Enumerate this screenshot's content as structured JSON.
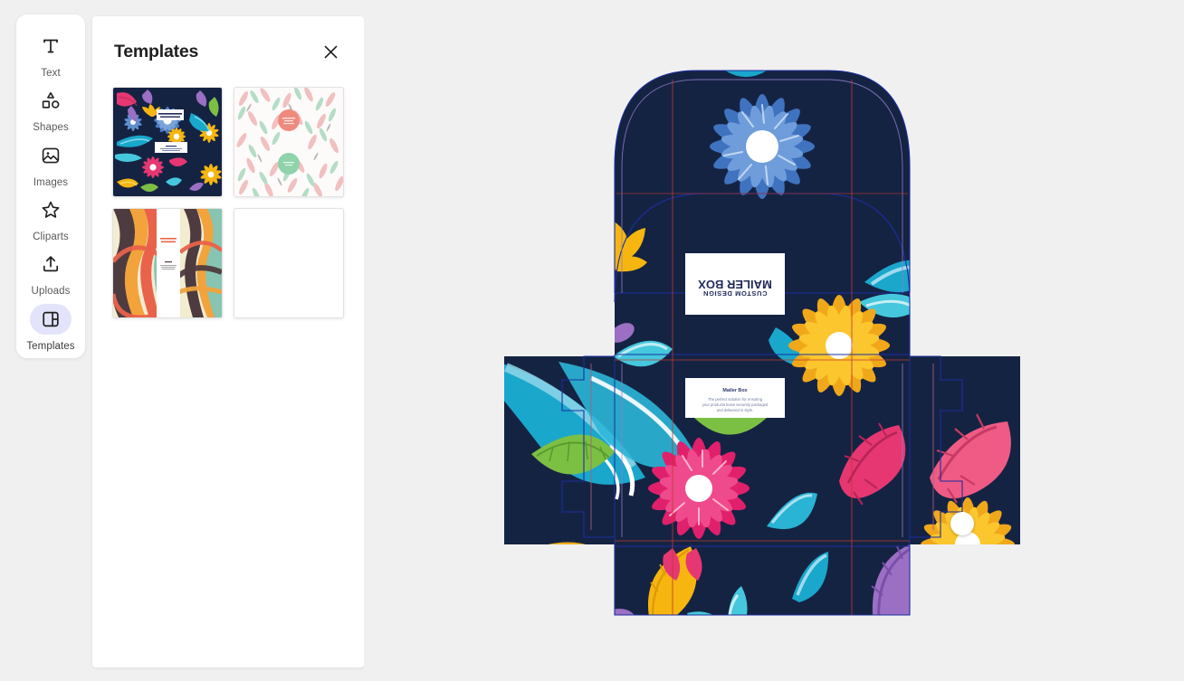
{
  "app": {
    "background_color": "#f0f0f0",
    "panel_color": "#ffffff"
  },
  "sidebar": {
    "items": [
      {
        "label": "Text",
        "icon": "text-icon",
        "active": false
      },
      {
        "label": "Shapes",
        "icon": "shapes-icon",
        "active": false
      },
      {
        "label": "Images",
        "icon": "images-icon",
        "active": false
      },
      {
        "label": "Cliparts",
        "icon": "star-icon",
        "active": false
      },
      {
        "label": "Uploads",
        "icon": "upload-icon",
        "active": false
      },
      {
        "label": "Templates",
        "icon": "templates-icon",
        "active": true
      }
    ],
    "active_pill_color": "#e3e4fb"
  },
  "templates_panel": {
    "title": "Templates",
    "close_icon": "close-icon",
    "thumbnails": [
      {
        "name": "floral-dark-template",
        "description": "Dark navy floral pattern mailer box",
        "selected": true
      },
      {
        "name": "leaves-light-template",
        "description": "Light leaf pattern with pink and green badges",
        "selected": false
      },
      {
        "name": "retro-waves-template",
        "description": "Retro wavy stripes with white center panel",
        "selected": false
      },
      {
        "name": "blank-template",
        "description": "Blank white template",
        "selected": false
      }
    ]
  },
  "canvas": {
    "design_name": "mailer-box-dieline",
    "background_color": "#f0f0f0",
    "artwork_base_color": "#152343",
    "dieline": {
      "cut_line_color": "#c0392b",
      "fold_line_color": "#1b2ea0",
      "bleed_line_color": "#8f7fc8"
    },
    "labels": {
      "front_label_line1": "MAILER BOX",
      "front_label_line2": "CUSTOM DESIGN",
      "front_label_rotated": "180deg",
      "side_label_title": "Mailer Box",
      "side_label_body": "The perfect solution for ensuring your products leave securely packaged and delivered in style."
    },
    "selection": {
      "handle_positions": [
        "bottom-right"
      ],
      "handle_color": "#ffffff"
    },
    "palette": {
      "navy": "#152343",
      "blue_flower": "#4a7ec4",
      "blue_flower_light": "#7ba3da",
      "pink": "#e63772",
      "pink_light": "#ef5b84",
      "yellow": "#f6b60f",
      "yellow_deep": "#e8a00c",
      "teal": "#1aa7cc",
      "teal_light": "#45c8dd",
      "green": "#7cc043",
      "purple": "#9b6fc4",
      "white": "#ffffff"
    }
  }
}
